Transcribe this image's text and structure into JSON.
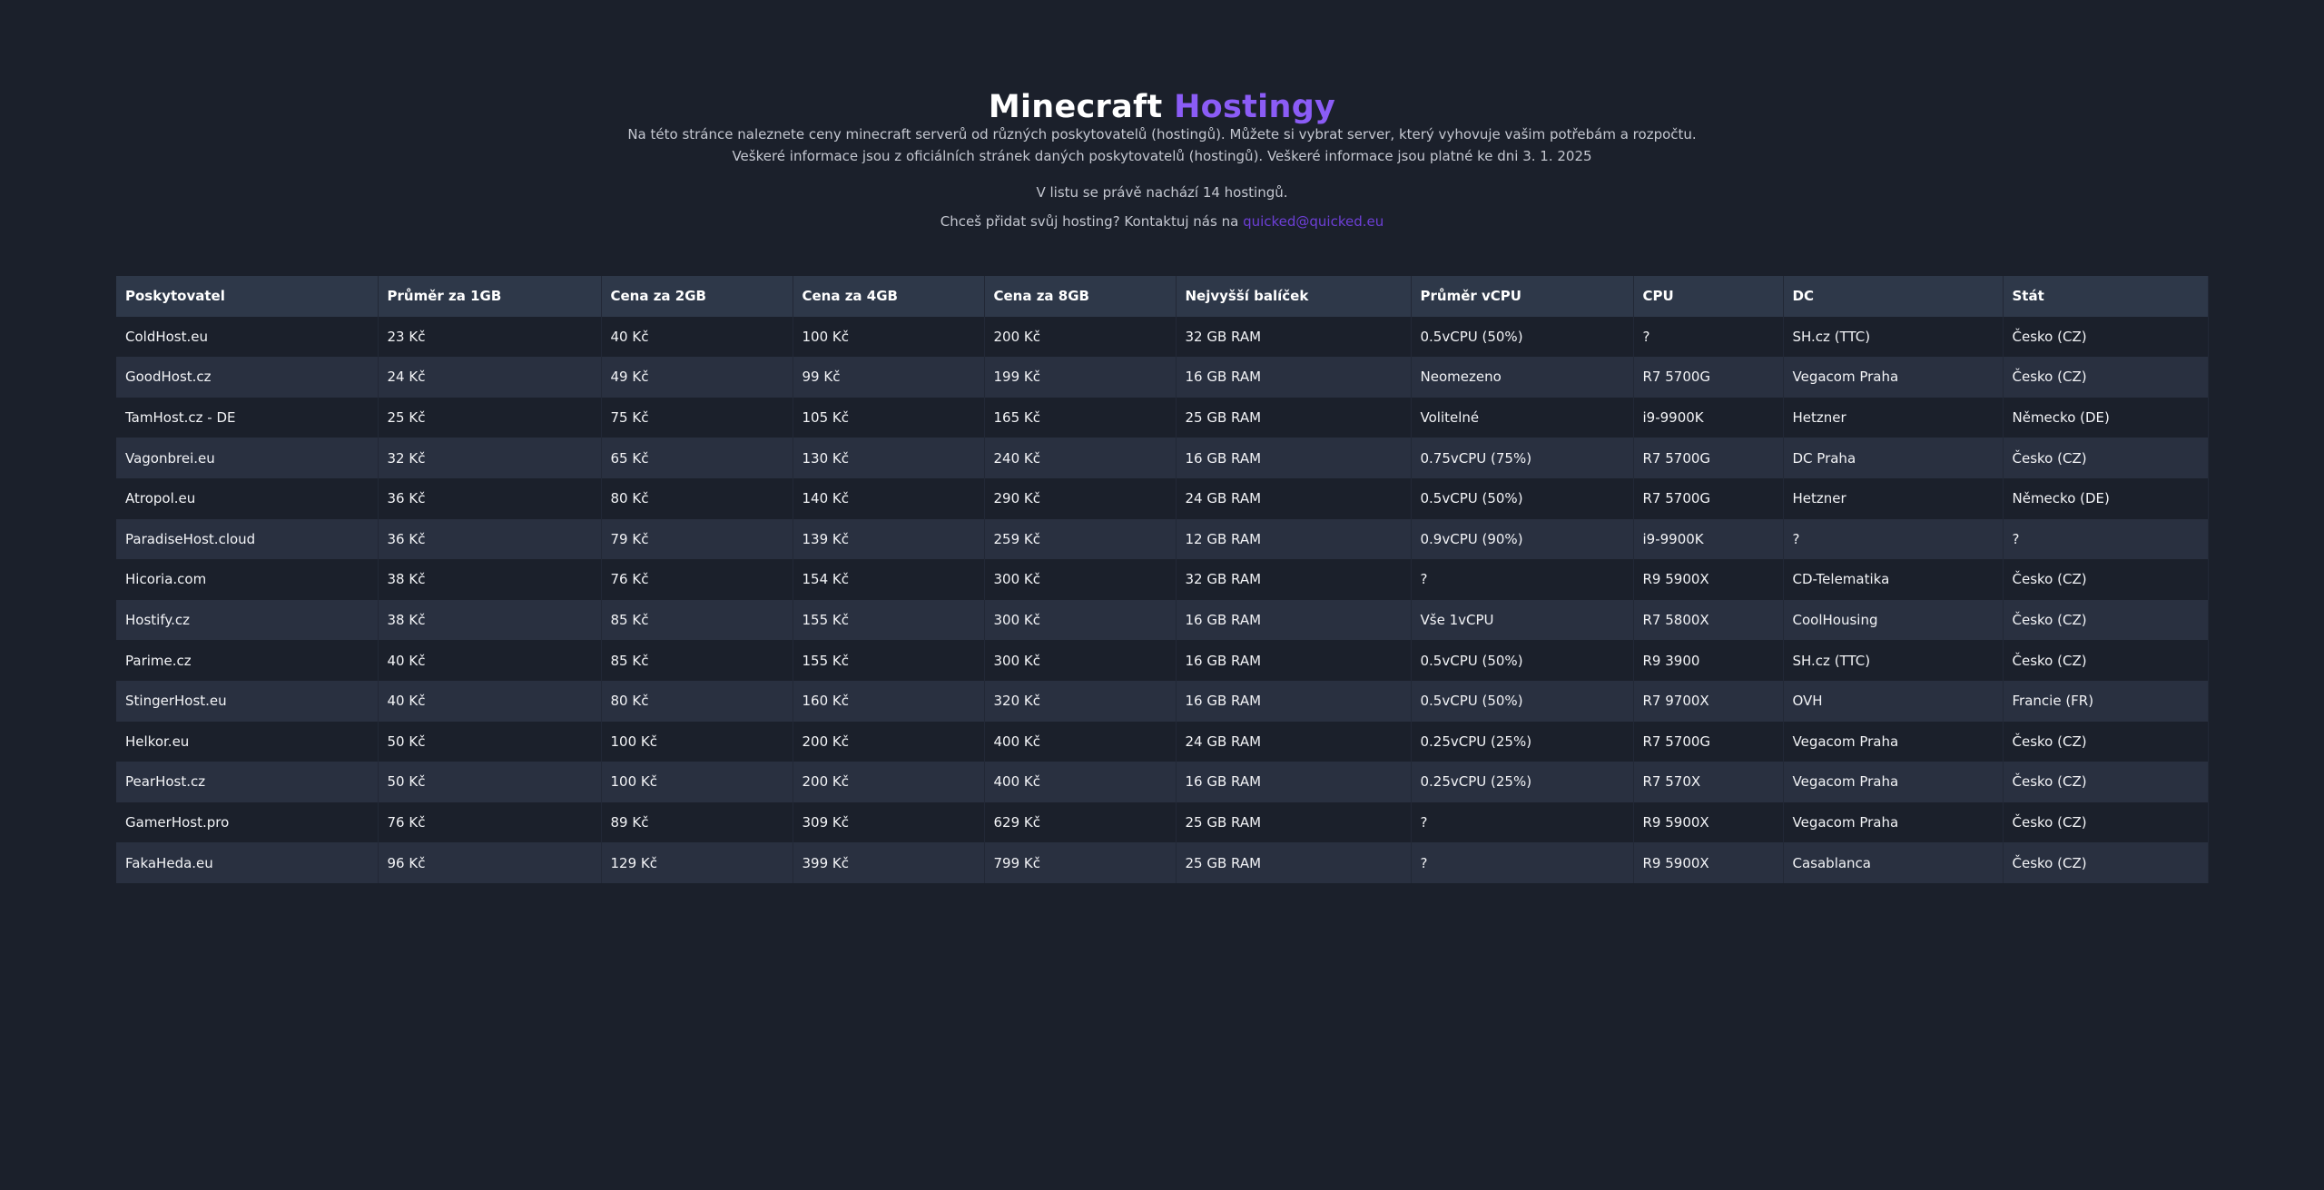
{
  "header": {
    "title_main": "Minecraft",
    "title_accent": "Hostingy",
    "description_line1": "Na této stránce naleznete ceny minecraft serverů od různých poskytovatelů (hostingů). Můžete si vybrat server, který vyhovuje vašim potřebám a rozpočtu.",
    "description_line2": "Veškeré informace jsou z oficiálních stránek daných poskytovatelů (hostingů). Veškeré informace jsou platné ke dni 3. 1. 2025",
    "count_text": "V listu se právě nachází 14 hostingů.",
    "contact_text": "Chceš přidat svůj hosting? Kontaktuj nás na",
    "contact_email": "quicked@quicked.eu"
  },
  "colors": {
    "background": "#1b202b",
    "accent": "#8b5cf6",
    "link": "#6d3fd6",
    "table_header": "#2e3849",
    "row_alt": "#293040"
  },
  "table": {
    "headers": [
      "Poskytovatel",
      "Průměr za 1GB",
      "Cena za 2GB",
      "Cena za 4GB",
      "Cena za 8GB",
      "Nejvyšší balíček",
      "Průměr vCPU",
      "CPU",
      "DC",
      "Stát"
    ],
    "rows": [
      [
        "ColdHost.eu",
        "23 Kč",
        "40 Kč",
        "100 Kč",
        "200 Kč",
        "32 GB RAM",
        "0.5vCPU (50%)",
        "?",
        "SH.cz (TTC)",
        "Česko (CZ)"
      ],
      [
        "GoodHost.cz",
        "24 Kč",
        "49 Kč",
        "99 Kč",
        "199 Kč",
        "16 GB RAM",
        "Neomezeno",
        "R7 5700G",
        "Vegacom Praha",
        "Česko (CZ)"
      ],
      [
        "TamHost.cz - DE",
        "25 Kč",
        "75 Kč",
        "105 Kč",
        "165 Kč",
        "25 GB RAM",
        "Volitelné",
        "i9-9900K",
        "Hetzner",
        "Německo (DE)"
      ],
      [
        "Vagonbrei.eu",
        "32 Kč",
        "65 Kč",
        "130 Kč",
        "240 Kč",
        "16 GB RAM",
        "0.75vCPU (75%)",
        "R7 5700G",
        "DC Praha",
        "Česko (CZ)"
      ],
      [
        "Atropol.eu",
        "36 Kč",
        "80 Kč",
        "140 Kč",
        "290 Kč",
        "24 GB RAM",
        "0.5vCPU (50%)",
        "R7 5700G",
        "Hetzner",
        "Německo (DE)"
      ],
      [
        "ParadiseHost.cloud",
        "36 Kč",
        "79 Kč",
        "139 Kč",
        "259 Kč",
        "12 GB RAM",
        "0.9vCPU (90%)",
        "i9-9900K",
        "?",
        "?"
      ],
      [
        "Hicoria.com",
        "38 Kč",
        "76 Kč",
        "154 Kč",
        "300 Kč",
        "32 GB RAM",
        "?",
        "R9 5900X",
        "CD-Telematika",
        "Česko (CZ)"
      ],
      [
        "Hostify.cz",
        "38 Kč",
        "85 Kč",
        "155 Kč",
        "300 Kč",
        "16 GB RAM",
        "Vše 1vCPU",
        "R7 5800X",
        "CoolHousing",
        "Česko (CZ)"
      ],
      [
        "Parime.cz",
        "40 Kč",
        "85 Kč",
        "155 Kč",
        "300 Kč",
        "16 GB RAM",
        "0.5vCPU (50%)",
        "R9 3900",
        "SH.cz (TTC)",
        "Česko (CZ)"
      ],
      [
        "StingerHost.eu",
        "40 Kč",
        "80 Kč",
        "160 Kč",
        "320 Kč",
        "16 GB RAM",
        "0.5vCPU (50%)",
        "R7 9700X",
        "OVH",
        "Francie (FR)"
      ],
      [
        "Helkor.eu",
        "50 Kč",
        "100 Kč",
        "200 Kč",
        "400 Kč",
        "24 GB RAM",
        "0.25vCPU (25%)",
        "R7 5700G",
        "Vegacom Praha",
        "Česko (CZ)"
      ],
      [
        "PearHost.cz",
        "50 Kč",
        "100 Kč",
        "200 Kč",
        "400 Kč",
        "16 GB RAM",
        "0.25vCPU (25%)",
        "R7 570X",
        "Vegacom Praha",
        "Česko (CZ)"
      ],
      [
        "GamerHost.pro",
        "76 Kč",
        "89 Kč",
        "309 Kč",
        "629 Kč",
        "25 GB RAM",
        "?",
        "R9 5900X",
        "Vegacom Praha",
        "Česko (CZ)"
      ],
      [
        "FakaHeda.eu",
        "96 Kč",
        "129 Kč",
        "399 Kč",
        "799 Kč",
        "25 GB RAM",
        "?",
        "R9 5900X",
        "Casablanca",
        "Česko (CZ)"
      ]
    ]
  }
}
